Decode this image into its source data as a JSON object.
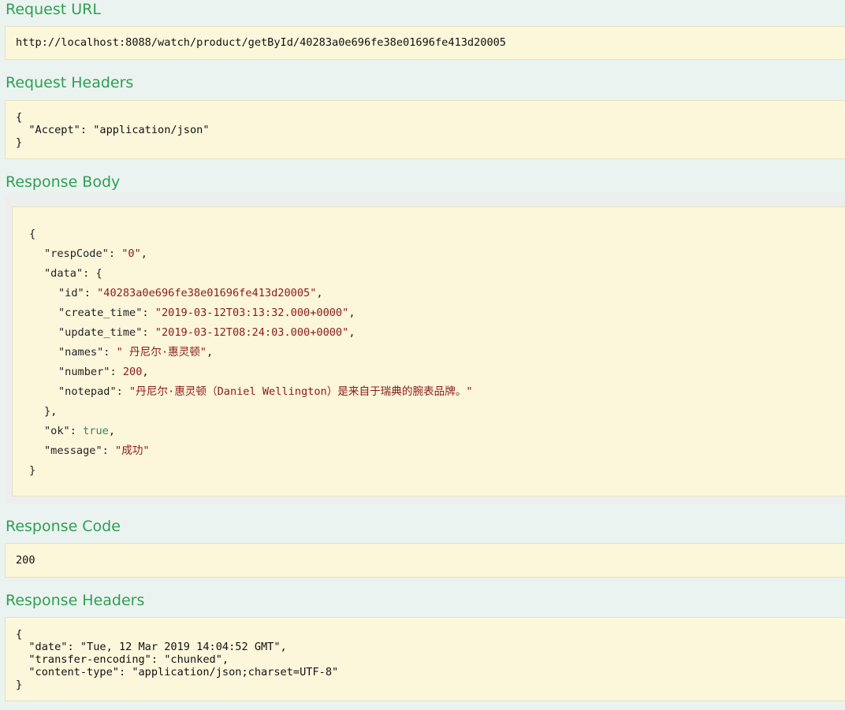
{
  "request_url": {
    "title": "Request URL",
    "value": "http://localhost:8088/watch/product/getById/40283a0e696fe38e01696fe413d20005"
  },
  "request_headers": {
    "title": "Request Headers",
    "lines": [
      "{",
      "  \"Accept\": \"application/json\"",
      "}"
    ]
  },
  "response_body": {
    "title": "Response Body",
    "open": "{",
    "close": "}",
    "data_open": "{",
    "data_close": "},",
    "respCode": {
      "key": "\"respCode\"",
      "value": "\"0\""
    },
    "data_key": "\"data\"",
    "fields": {
      "id": {
        "key": "\"id\"",
        "value": "\"40283a0e696fe38e01696fe413d20005\""
      },
      "create_time": {
        "key": "\"create_time\"",
        "value": "\"2019-03-12T03:13:32.000+0000\""
      },
      "update_time": {
        "key": "\"update_time\"",
        "value": "\"2019-03-12T08:24:03.000+0000\""
      },
      "names": {
        "key": "\"names\"",
        "value": "\" 丹尼尔·惠灵顿\""
      },
      "number": {
        "key": "\"number\"",
        "value": "200"
      },
      "notepad": {
        "key": "\"notepad\"",
        "value": "\"丹尼尔·惠灵顿（Daniel Wellington）是来自于瑞典的腕表品牌。\""
      }
    },
    "ok": {
      "key": "\"ok\"",
      "value": "true"
    },
    "message": {
      "key": "\"message\"",
      "value": "\"成功\""
    }
  },
  "response_code": {
    "title": "Response Code",
    "value": "200"
  },
  "response_headers": {
    "title": "Response Headers",
    "lines": [
      "{",
      "  \"date\": \"Tue, 12 Mar 2019 14:04:52 GMT\",",
      "  \"transfer-encoding\": \"chunked\",",
      "  \"content-type\": \"application/json;charset=UTF-8\"",
      "}"
    ]
  }
}
